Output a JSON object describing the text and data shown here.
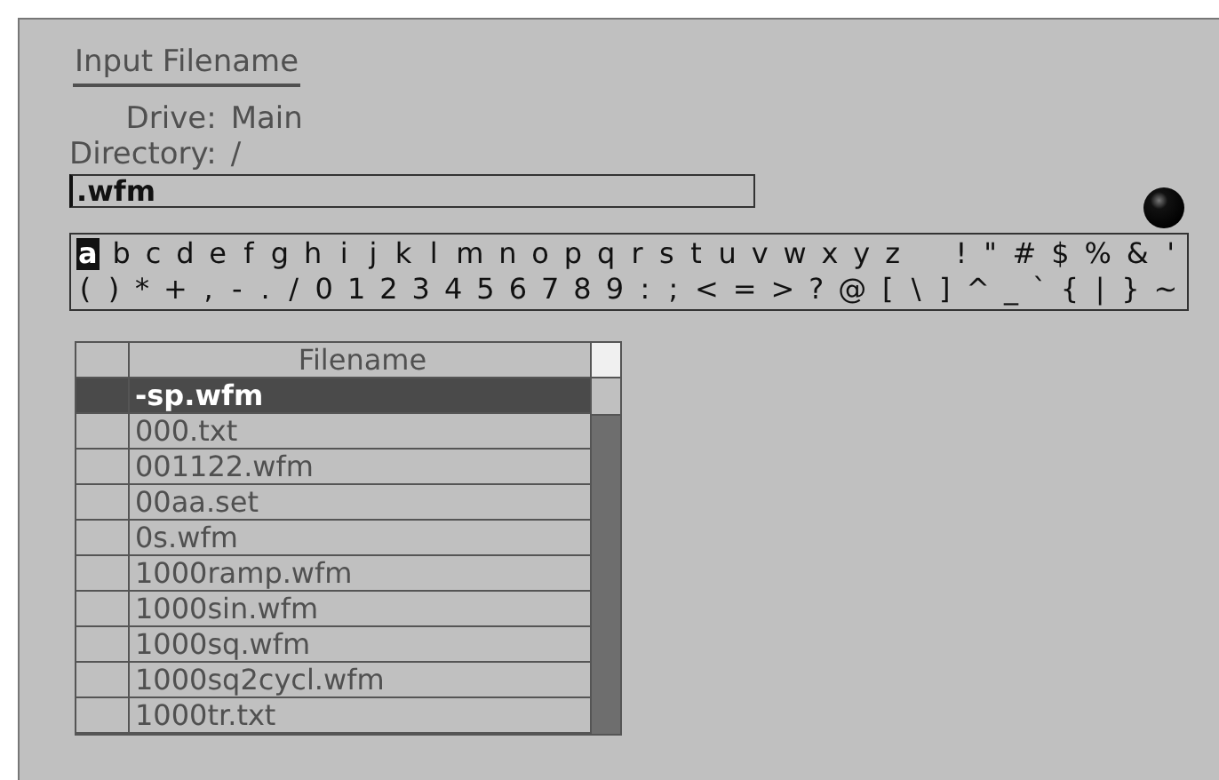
{
  "dialog": {
    "title": "Input Filename",
    "drive_label": "Drive:",
    "drive": "Main",
    "directory_label": "Directory:",
    "directory": "/"
  },
  "filename_field": {
    "value": ".wfm"
  },
  "keyboard": {
    "keys": [
      {
        "char": "a",
        "selected": true
      },
      {
        "char": "b",
        "selected": false
      },
      {
        "char": "c",
        "selected": false
      },
      {
        "char": "d",
        "selected": false
      },
      {
        "char": "e",
        "selected": false
      },
      {
        "char": "f",
        "selected": false
      },
      {
        "char": "g",
        "selected": false
      },
      {
        "char": "h",
        "selected": false
      },
      {
        "char": "i",
        "selected": false
      },
      {
        "char": "j",
        "selected": false
      },
      {
        "char": "k",
        "selected": false
      },
      {
        "char": "l",
        "selected": false
      },
      {
        "char": "m",
        "selected": false
      },
      {
        "char": "n",
        "selected": false
      },
      {
        "char": "o",
        "selected": false
      },
      {
        "char": "p",
        "selected": false
      },
      {
        "char": "q",
        "selected": false
      },
      {
        "char": "r",
        "selected": false
      },
      {
        "char": "s",
        "selected": false
      },
      {
        "char": "t",
        "selected": false
      },
      {
        "char": "u",
        "selected": false
      },
      {
        "char": "v",
        "selected": false
      },
      {
        "char": "w",
        "selected": false
      },
      {
        "char": "x",
        "selected": false
      },
      {
        "char": "y",
        "selected": false
      },
      {
        "char": "z",
        "selected": false
      },
      {
        "char": "!",
        "selected": false,
        "space_before": true
      },
      {
        "char": "\"",
        "selected": false
      },
      {
        "char": "#",
        "selected": false
      },
      {
        "char": "$",
        "selected": false
      },
      {
        "char": "%",
        "selected": false
      },
      {
        "char": "&",
        "selected": false
      },
      {
        "char": "'",
        "selected": false
      },
      {
        "char": "(",
        "selected": false,
        "new_line": true
      },
      {
        "char": ")",
        "selected": false
      },
      {
        "char": "*",
        "selected": false
      },
      {
        "char": "+",
        "selected": false
      },
      {
        "char": ",",
        "selected": false
      },
      {
        "char": "-",
        "selected": false
      },
      {
        "char": ".",
        "selected": false
      },
      {
        "char": "/",
        "selected": false
      },
      {
        "char": "0",
        "selected": false
      },
      {
        "char": "1",
        "selected": false
      },
      {
        "char": "2",
        "selected": false
      },
      {
        "char": "3",
        "selected": false
      },
      {
        "char": "4",
        "selected": false
      },
      {
        "char": "5",
        "selected": false
      },
      {
        "char": "6",
        "selected": false
      },
      {
        "char": "7",
        "selected": false
      },
      {
        "char": "8",
        "selected": false
      },
      {
        "char": "9",
        "selected": false
      },
      {
        "char": ":",
        "selected": false
      },
      {
        "char": ";",
        "selected": false
      },
      {
        "char": "<",
        "selected": false
      },
      {
        "char": "=",
        "selected": false
      },
      {
        "char": ">",
        "selected": false
      },
      {
        "char": "?",
        "selected": false
      },
      {
        "char": "@",
        "selected": false
      },
      {
        "char": "[",
        "selected": false
      },
      {
        "char": "\\",
        "selected": false
      },
      {
        "char": "]",
        "selected": false
      },
      {
        "char": "^",
        "selected": false
      },
      {
        "char": "_",
        "selected": false
      },
      {
        "char": "`",
        "selected": false
      },
      {
        "char": "{",
        "selected": false
      },
      {
        "char": "|",
        "selected": false
      },
      {
        "char": "}",
        "selected": false
      },
      {
        "char": "~",
        "selected": false
      }
    ]
  },
  "file_table": {
    "columns": [
      "Filename"
    ],
    "rows": [
      {
        "filename": "-sp.wfm",
        "selected": true
      },
      {
        "filename": "000.txt",
        "selected": false
      },
      {
        "filename": "001122.wfm",
        "selected": false
      },
      {
        "filename": "00aa.set",
        "selected": false
      },
      {
        "filename": "0s.wfm",
        "selected": false
      },
      {
        "filename": "1000ramp.wfm",
        "selected": false
      },
      {
        "filename": "1000sin.wfm",
        "selected": false
      },
      {
        "filename": "1000sq.wfm",
        "selected": false
      },
      {
        "filename": "1000sq2cycl.wfm",
        "selected": false
      },
      {
        "filename": "1000tr.txt",
        "selected": false
      }
    ]
  }
}
